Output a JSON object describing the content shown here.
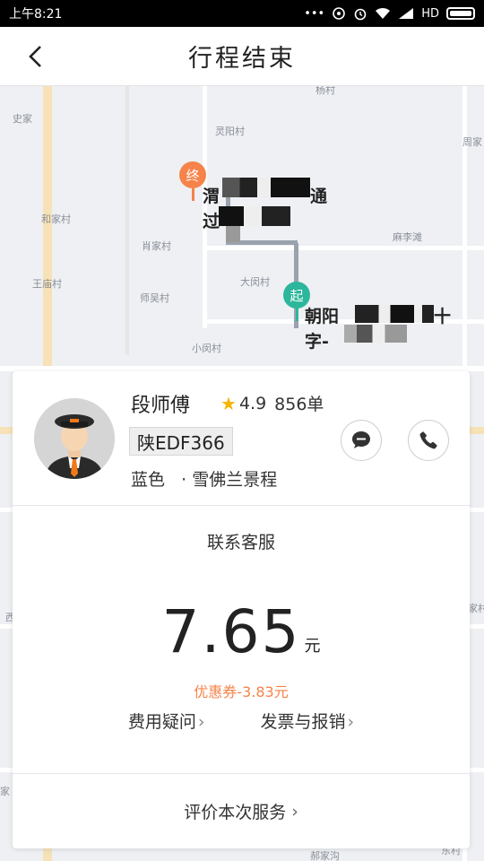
{
  "status_bar": {
    "time": "上午8:21",
    "dots": "•••",
    "network": "HD"
  },
  "header": {
    "title": "行程结束"
  },
  "map": {
    "places": [
      "史家",
      "灵阳村",
      "周家",
      "和家村",
      "肖家村",
      "麻李滩",
      "王庙村",
      "师吴村",
      "大闵村",
      "小闵村",
      "西",
      "家",
      "郝家沟",
      "家村",
      "杨村",
      "东村"
    ],
    "end_pin_label": "终",
    "start_pin_label": "起",
    "end_address_line1": "渭",
    "end_address_line1_b": "通",
    "end_address_line2": "过",
    "start_address_line1": "朝阳",
    "start_address_line1_b": "十",
    "start_address_line2": "字-"
  },
  "driver": {
    "name": "段师傅",
    "rating": "4.9",
    "orders": "856单",
    "plate": "陕EDF366",
    "car_info": "蓝色   · 雪佛兰景程"
  },
  "trip": {
    "contact_service": "联系客服",
    "fare": "7.65",
    "fare_unit": "元",
    "coupon": "优惠券-3.83元",
    "fee_question": "费用疑问",
    "invoice": "发票与报销",
    "arrow": "›",
    "rate_service": "评价本次服务",
    "rate_arrow": "›"
  }
}
